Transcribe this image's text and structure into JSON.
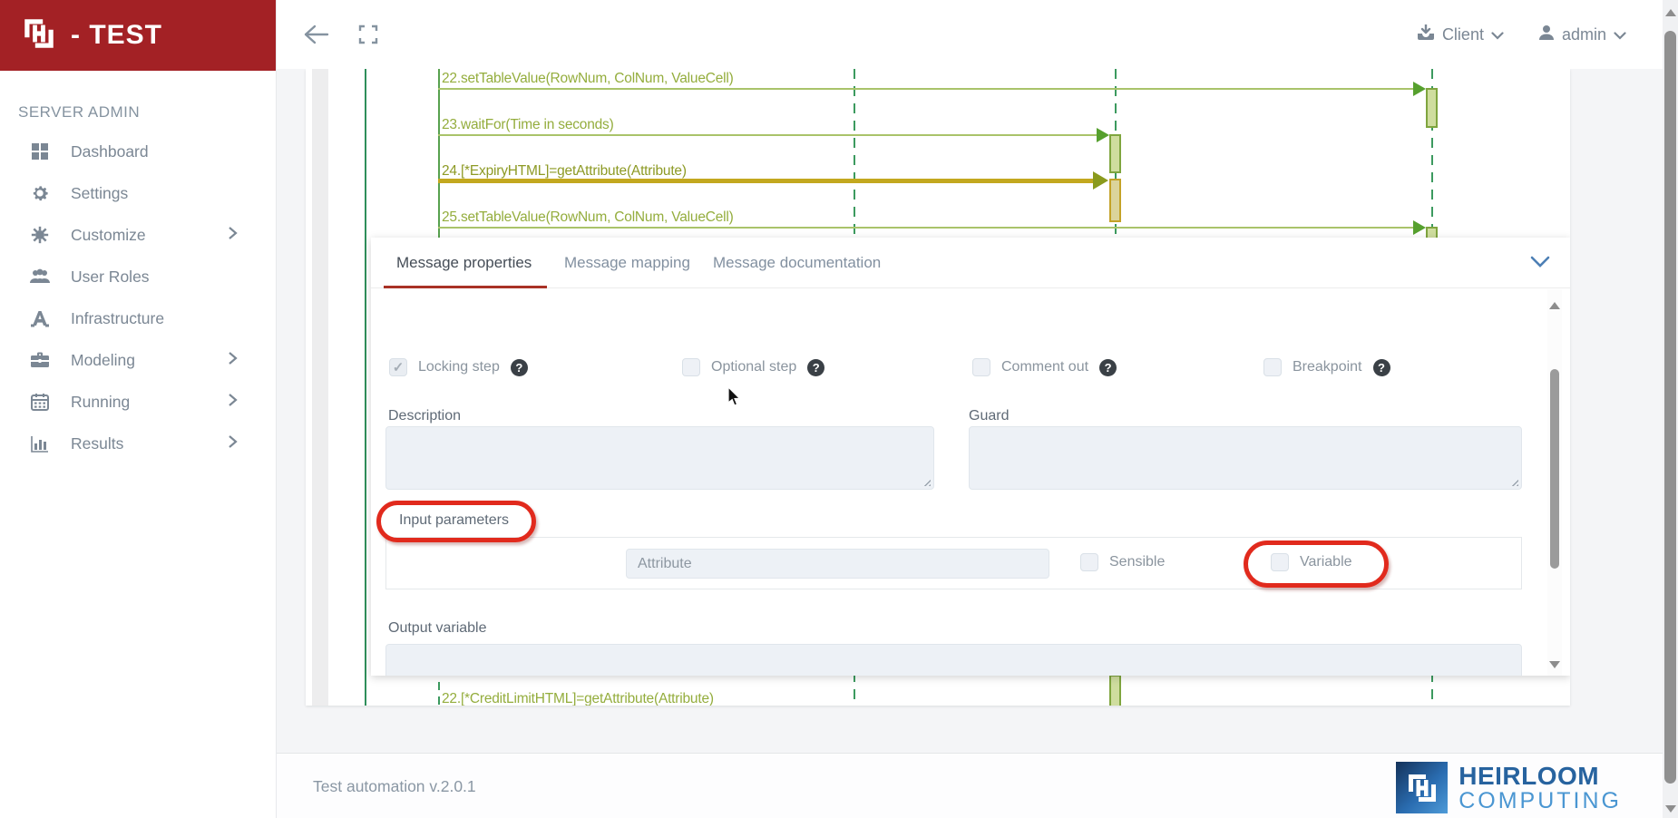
{
  "brand": {
    "title": "- TEST"
  },
  "topbar": {
    "client_label": "Client",
    "user_label": "admin"
  },
  "sidebar": {
    "section_label": "SERVER ADMIN",
    "items": [
      {
        "label": "Dashboard",
        "icon": "dashboard-icon",
        "has_submenu": false
      },
      {
        "label": "Settings",
        "icon": "gear-icon",
        "has_submenu": false
      },
      {
        "label": "Customize",
        "icon": "cog-icon",
        "has_submenu": true
      },
      {
        "label": "User Roles",
        "icon": "users-icon",
        "has_submenu": false
      },
      {
        "label": "Infrastructure",
        "icon": "infrastructure-icon",
        "has_submenu": false
      },
      {
        "label": "Modeling",
        "icon": "briefcase-icon",
        "has_submenu": true
      },
      {
        "label": "Running",
        "icon": "calendar-icon",
        "has_submenu": true
      },
      {
        "label": "Results",
        "icon": "bar-chart-icon",
        "has_submenu": true
      }
    ]
  },
  "diagram": {
    "messages": [
      {
        "label": "22.setTableValue(RowNum, ColNum, ValueCell)",
        "selected": false
      },
      {
        "label": "23.waitFor(Time in seconds)",
        "selected": false
      },
      {
        "label": "24.[*ExpiryHTML]=getAttribute(Attribute)",
        "selected": true
      },
      {
        "label": "25.setTableValue(RowNum, ColNum, ValueCell)",
        "selected": false
      }
    ],
    "bottom_message": "22.[*CreditLimitHTML]=getAttribute(Attribute)"
  },
  "panel": {
    "tabs": [
      {
        "label": "Message properties",
        "active": true
      },
      {
        "label": "Message mapping",
        "active": false
      },
      {
        "label": "Message documentation",
        "active": false
      }
    ],
    "checkboxes": [
      {
        "label": "Locking step",
        "checked": true
      },
      {
        "label": "Optional step",
        "checked": false
      },
      {
        "label": "Comment out",
        "checked": false
      },
      {
        "label": "Breakpoint",
        "checked": false
      }
    ],
    "fields": {
      "description_label": "Description",
      "guard_label": "Guard",
      "input_parameters_label": "Input parameters",
      "attribute_placeholder": "Attribute",
      "sensible_label": "Sensible",
      "variable_label": "Variable",
      "output_variable_label": "Output variable"
    }
  },
  "footer": {
    "version_text": "Test automation v.2.0.1",
    "logo_line1": "HEIRLOOM",
    "logo_line2": "COMPUTING"
  },
  "colors": {
    "brand_red": "#a32125",
    "annotation_red": "#e12a1d",
    "tab_underline": "#a93226",
    "diagram_green": "#94ad3d",
    "diagram_selected_yellow": "#c3a81f",
    "lifeline_green": "#3c9a5f"
  },
  "icons": {
    "check": "✓",
    "question_mark": "?"
  }
}
